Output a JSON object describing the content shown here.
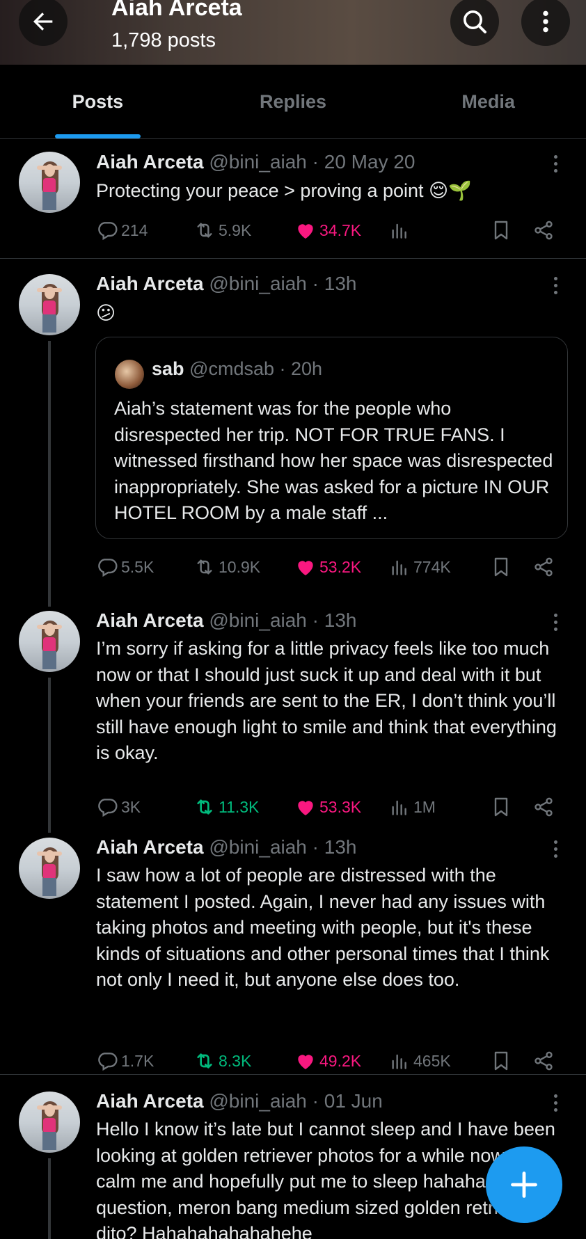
{
  "header": {
    "title": "Aiah Arceta",
    "subtitle": "1,798 posts"
  },
  "tabs": [
    {
      "label": "Posts"
    },
    {
      "label": "Replies"
    },
    {
      "label": "Media"
    }
  ],
  "posts": [
    {
      "name": "Aiah Arceta",
      "meta": "@bini_aiah · 20 May 20",
      "text": "Protecting your peace > proving a point 😌🌱",
      "replies": "214",
      "reposts": "5.9K",
      "likes": "34.7K",
      "views": ""
    },
    {
      "name": "Aiah Arceta",
      "meta": "@bini_aiah · 13h",
      "text": "😕",
      "quote": {
        "name": "sab",
        "meta": "@cmdsab · 20h",
        "text": "Aiah’s statement was for the people who disrespected her trip. NOT FOR TRUE FANS. I witnessed firsthand how her space was disrespected inappropriately. She was asked for a picture IN OUR HOTEL ROOM by a male staff ..."
      },
      "replies": "5.5K",
      "reposts": "10.9K",
      "likes": "53.2K",
      "views": "774K"
    },
    {
      "name": "Aiah Arceta",
      "meta": "@bini_aiah · 13h",
      "text": "I’m sorry if asking for a little privacy feels like too much now or that I should just suck it up and deal with it but when your friends are sent to the ER, I don’t think you’ll still have enough light to smile and think that everything is okay.",
      "replies": "3K",
      "reposts": "11.3K",
      "likes": "53.3K",
      "views": "1M"
    },
    {
      "name": "Aiah Arceta",
      "meta": "@bini_aiah · 13h",
      "text": "I saw how a lot of people are distressed with the statement I posted. Again, I never had any issues with taking photos and meeting with people, but it's these kinds of situations and other personal times that I think not only I need it, but anyone else does too.",
      "replies": "1.7K",
      "reposts": "8.3K",
      "likes": "49.2K",
      "views": "465K"
    },
    {
      "name": "Aiah Arceta",
      "meta": "@bini_aiah · 01 Jun",
      "text": "Hello I know it’s late but I cannot sleep and I have been looking at golden retriever photos for a while now to calm me and hopefully put me to sleep hahaha but question, meron bang medium sized golden retriever dito? Hahahahahahahehe"
    }
  ],
  "colors": {
    "accent": "#1d9bf0",
    "like": "#f91880",
    "repost": "#00ba7c",
    "muted": "#71767b"
  },
  "icons": [
    "back-arrow-icon",
    "search-icon",
    "more-vertical-icon",
    "reply-icon",
    "repost-icon",
    "heart-icon",
    "views-icon",
    "bookmark-icon",
    "share-icon",
    "plus-icon"
  ]
}
